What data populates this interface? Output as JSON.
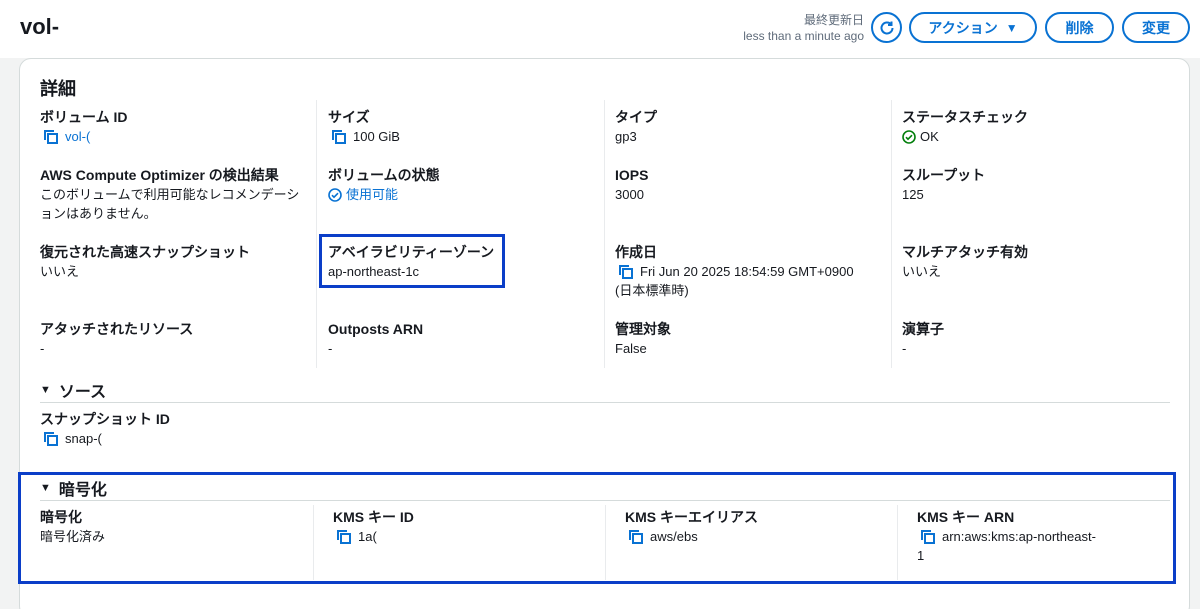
{
  "header": {
    "title": "vol-",
    "updated_label": "最終更新日",
    "updated_value": "less than a minute ago",
    "action_label": "アクション",
    "delete_label": "削除",
    "edit_label": "変更"
  },
  "details": {
    "title": "詳細",
    "fields": {
      "volume_id": {
        "label": "ボリューム ID",
        "value": "vol-("
      },
      "size": {
        "label": "サイズ",
        "value": "100 GiB"
      },
      "type": {
        "label": "タイプ",
        "value": "gp3"
      },
      "status_check": {
        "label": "ステータスチェック",
        "value": "OK"
      },
      "optimizer": {
        "label": "AWS Compute Optimizer の検出結果",
        "value": "このボリュームで利用可能なレコメンデーションはありません。"
      },
      "volume_state": {
        "label": "ボリュームの状態",
        "value": "使用可能"
      },
      "iops": {
        "label": "IOPS",
        "value": "3000"
      },
      "throughput": {
        "label": "スループット",
        "value": "125"
      },
      "fast_snapshot": {
        "label": "復元された高速スナップショット",
        "value": "いいえ"
      },
      "az": {
        "label": "アベイラビリティーゾーン",
        "value": "ap-northeast-1c"
      },
      "created": {
        "label": "作成日",
        "value": "Fri Jun 20 2025 18:54:59 GMT+0900",
        "value2": "(日本標準時)"
      },
      "multi_attach": {
        "label": "マルチアタッチ有効",
        "value": "いいえ"
      },
      "attached": {
        "label": "アタッチされたリソース",
        "value": "-"
      },
      "outposts": {
        "label": "Outposts ARN",
        "value": "-"
      },
      "managed": {
        "label": "管理対象",
        "value": "False"
      },
      "operator": {
        "label": "演算子",
        "value": "-"
      }
    }
  },
  "source": {
    "title": "ソース",
    "snapshot_label": "スナップショット ID",
    "snapshot_value": "snap-("
  },
  "encryption": {
    "title": "暗号化",
    "enc_label": "暗号化",
    "enc_value": "暗号化済み",
    "kms_id_label": "KMS キー ID",
    "kms_id_value": "1a(",
    "kms_alias_label": "KMS キーエイリアス",
    "kms_alias_value": "aws/ebs",
    "kms_arn_label": "KMS キー ARN",
    "kms_arn_value": "arn:aws:kms:ap-northeast-",
    "kms_arn_value2": "1"
  },
  "colors": {
    "link": "#0972d3",
    "ok": "#037f0c",
    "highlight": "#0b3ec8"
  }
}
